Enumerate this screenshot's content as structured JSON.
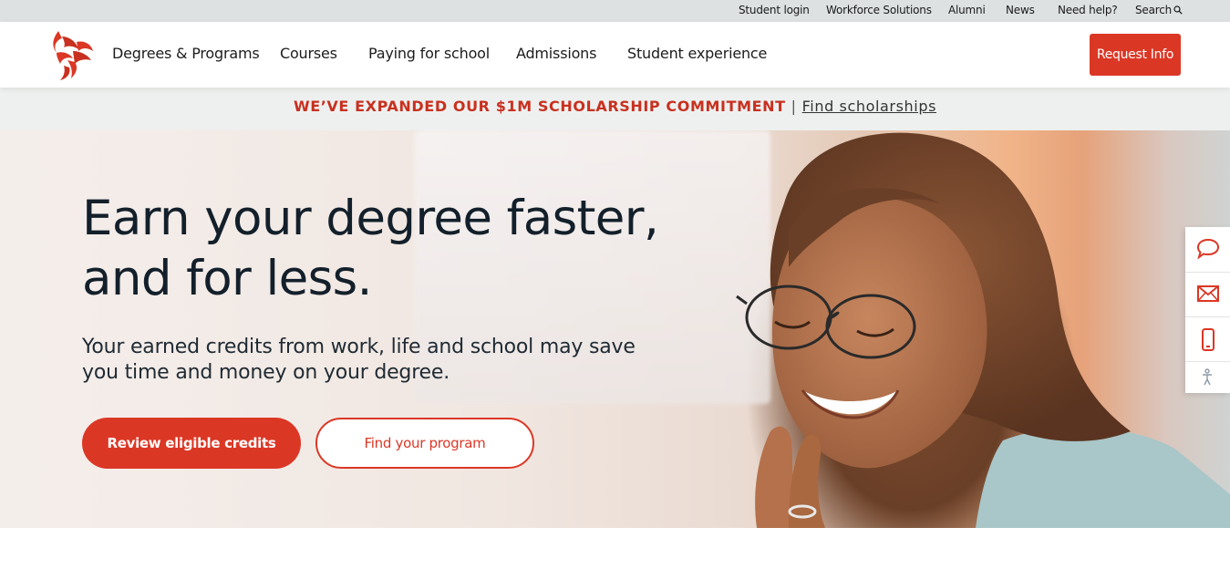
{
  "utility_nav": {
    "student_login": "Student login",
    "workforce_solutions": "Workforce Solutions",
    "alumni": "Alumni",
    "news": "News",
    "need_help": "Need help?",
    "search": "Search"
  },
  "main_nav": {
    "items": [
      "Degrees & Programs",
      "Courses",
      "Paying for school",
      "Admissions",
      "Student experience"
    ],
    "request_info": "Request Info"
  },
  "promo": {
    "headline": "WE’VE EXPANDED OUR $1M SCHOLARSHIP COMMITMENT",
    "separator": "|",
    "link": "Find scholarships"
  },
  "hero": {
    "title_line1": "Earn your degree faster,",
    "title_line2": "and for less.",
    "subtitle": "Your earned credits from work, life and school may save you time and money on your degree.",
    "primary_cta": "Review eligible credits",
    "secondary_cta": "Find your program"
  },
  "contact_rail": {
    "icons": [
      "chat-icon",
      "email-icon",
      "phone-icon",
      "accessibility-icon"
    ]
  },
  "colors": {
    "brand_red": "#db3725",
    "promo_red": "#c8301f",
    "utility_bg": "#dde1e2",
    "promo_bg": "#eef0ef",
    "heading": "#13202b"
  }
}
